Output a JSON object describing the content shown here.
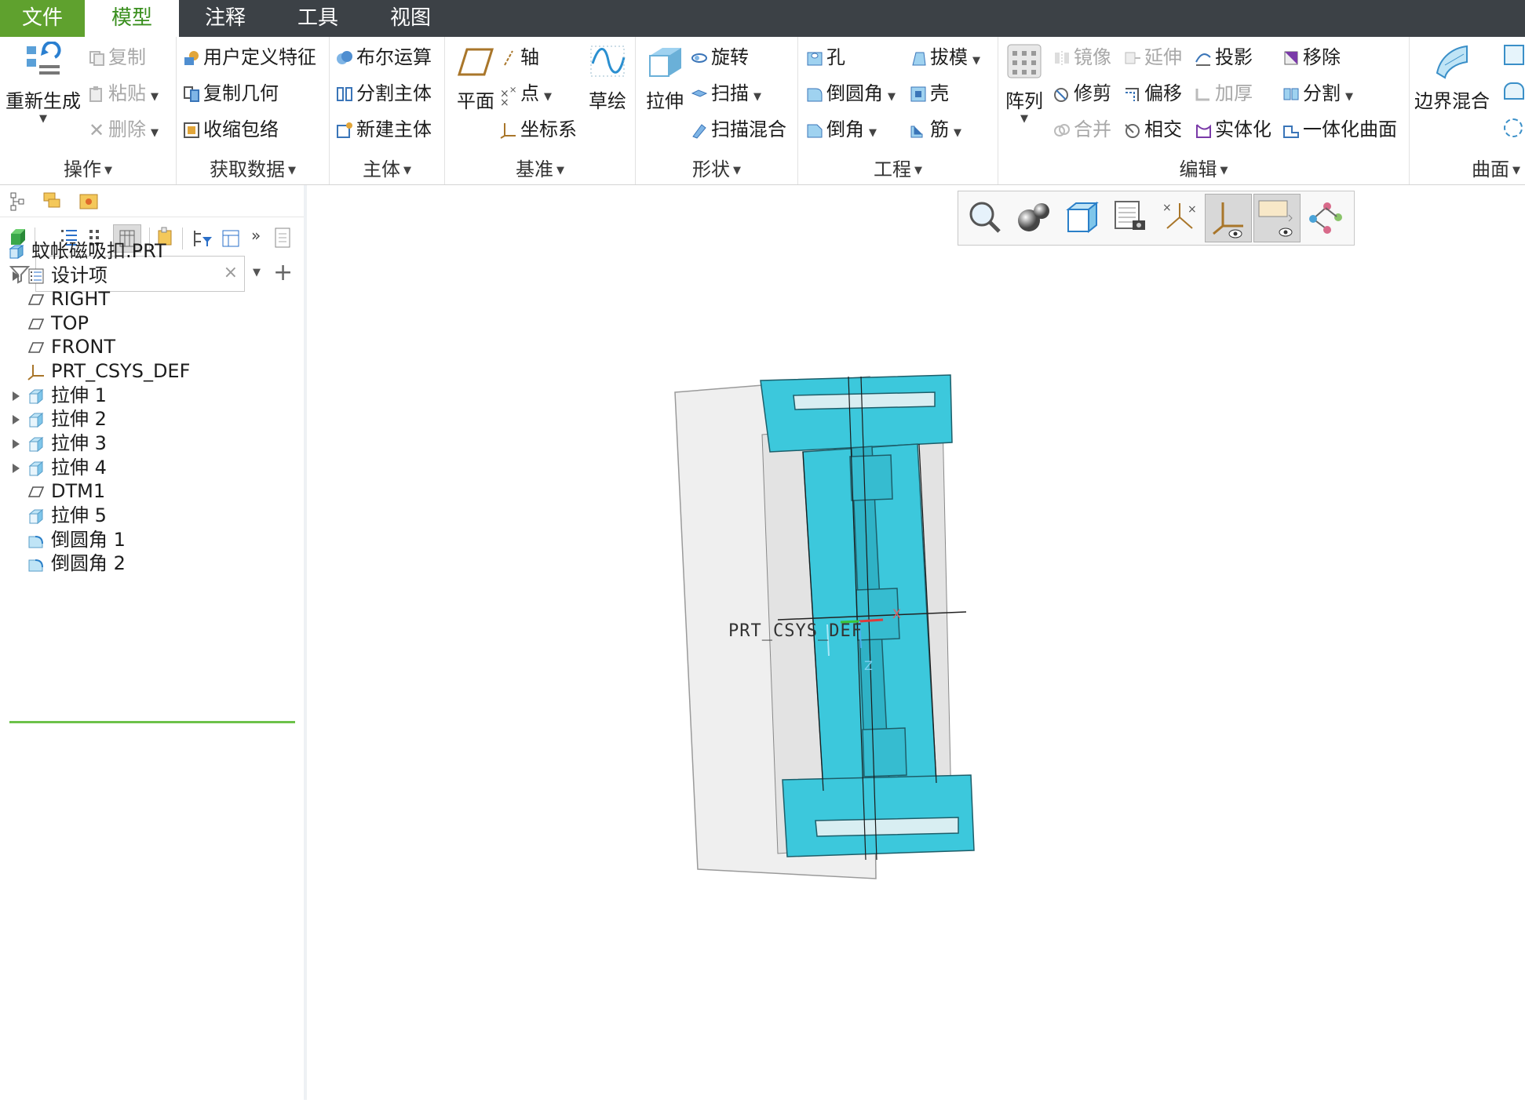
{
  "menu": {
    "tabs": [
      "文件",
      "模型",
      "注释",
      "工具",
      "视图"
    ]
  },
  "ribbon": {
    "operations": {
      "regenerate": "重新生成",
      "copy": "复制",
      "paste": "粘贴",
      "delete": "删除",
      "label": "操作"
    },
    "get_data": {
      "udf": "用户定义特征",
      "copy_geom": "复制几何",
      "shrinkwrap": "收缩包络",
      "label": "获取数据"
    },
    "body": {
      "boolean": "布尔运算",
      "split_body": "分割主体",
      "new_body": "新建主体",
      "label": "主体"
    },
    "datum": {
      "plane": "平面",
      "axis": "轴",
      "point": "点",
      "csys": "坐标系",
      "sketch": "草绘",
      "label": "基准"
    },
    "shapes": {
      "extrude": "拉伸",
      "revolve": "旋转",
      "sweep": "扫描",
      "swept_blend": "扫描混合",
      "label": "形状"
    },
    "engineering": {
      "hole": "孔",
      "draft": "拔模",
      "round": "倒圆角",
      "shell": "壳",
      "chamfer": "倒角",
      "rib": "筋",
      "label": "工程"
    },
    "editing": {
      "pattern": "阵列",
      "mirror": "镜像",
      "extend": "延伸",
      "project": "投影",
      "remove": "移除",
      "trim": "修剪",
      "offset": "偏移",
      "thicken": "加厚",
      "split": "分割",
      "merge": "合并",
      "intersect": "相交",
      "solidify": "实体化",
      "unify": "一体化曲面",
      "label": "编辑"
    },
    "surfaces": {
      "boundary_blend": "边界混合",
      "label": "曲面"
    }
  },
  "tree": {
    "search_placeholder": "",
    "items": [
      {
        "label": "蚊帐磁吸扣.PRT",
        "icon": "part-icon",
        "expand": false,
        "level": 0
      },
      {
        "label": "设计项",
        "icon": "design-items-icon",
        "expand": true,
        "level": 1
      },
      {
        "label": "RIGHT",
        "icon": "datum-plane-icon",
        "expand": false,
        "level": 1
      },
      {
        "label": "TOP",
        "icon": "datum-plane-icon",
        "expand": false,
        "level": 1
      },
      {
        "label": "FRONT",
        "icon": "datum-plane-icon",
        "expand": false,
        "level": 1
      },
      {
        "label": "PRT_CSYS_DEF",
        "icon": "csys-icon",
        "expand": false,
        "level": 1
      },
      {
        "label": "拉伸 1",
        "icon": "extrude-icon",
        "expand": true,
        "level": 1
      },
      {
        "label": "拉伸 2",
        "icon": "extrude-icon",
        "expand": true,
        "level": 1
      },
      {
        "label": "拉伸 3",
        "icon": "extrude-icon",
        "expand": true,
        "level": 1
      },
      {
        "label": "拉伸 4",
        "icon": "extrude-icon",
        "expand": true,
        "level": 1
      },
      {
        "label": "DTM1",
        "icon": "datum-plane-icon",
        "expand": false,
        "level": 1
      },
      {
        "label": "拉伸 5",
        "icon": "extrude-icon",
        "expand": false,
        "level": 1
      },
      {
        "label": "倒圆角 1",
        "icon": "round-icon",
        "expand": false,
        "level": 1
      },
      {
        "label": "倒圆角 2",
        "icon": "round-icon",
        "expand": false,
        "level": 1
      }
    ]
  },
  "viewport": {
    "csys_label": "PRT_CSYS_DEF",
    "axis_x": "X",
    "axis_z": "Z",
    "colors": {
      "model": "#3cc8dc",
      "plane": "#efefef"
    }
  }
}
